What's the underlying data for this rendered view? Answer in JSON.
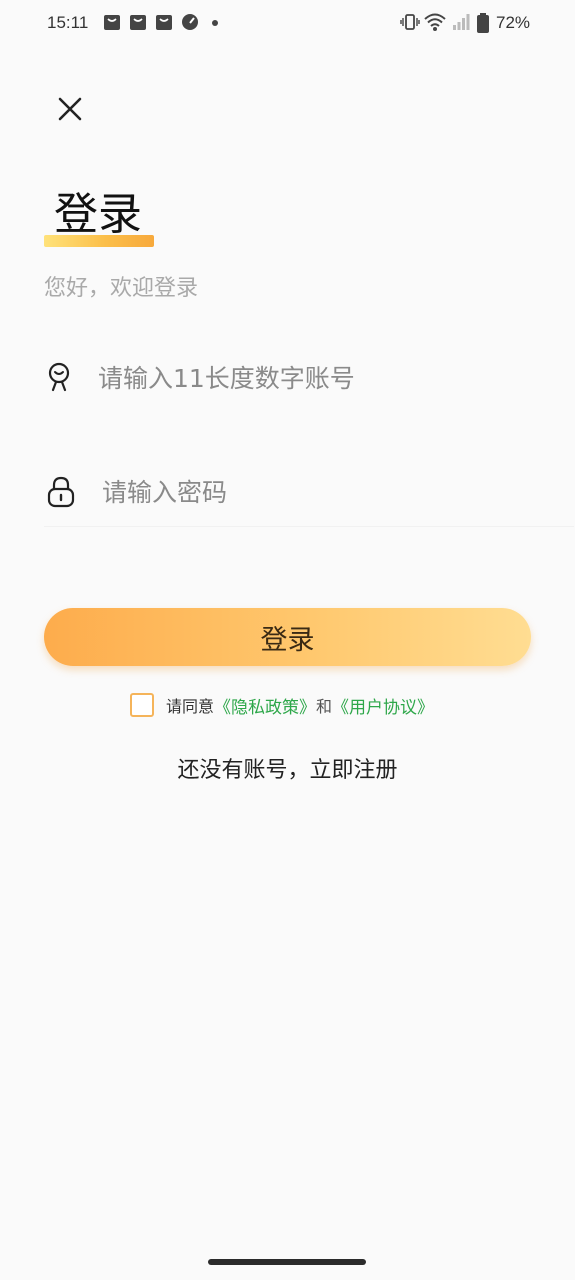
{
  "status_bar": {
    "time": "15:11",
    "battery_text": "72%",
    "icons": [
      "bag-icon",
      "bag-icon",
      "bag-icon",
      "gauge-icon",
      "dot-icon",
      "vibrate-icon",
      "wifi-icon",
      "signal-icon",
      "battery-icon"
    ]
  },
  "header": {
    "close_icon": "close-icon",
    "title": "登录",
    "subtitle": "您好，欢迎登录"
  },
  "form": {
    "account_placeholder": "请输入11长度数字账号",
    "account_value": "",
    "password_placeholder": "请输入密码",
    "password_value": "",
    "login_label": "登录"
  },
  "agreement": {
    "prefix": "请同意",
    "privacy": "《隐私政策》",
    "and": "和",
    "terms": "《用户协议》",
    "checked": false
  },
  "register": {
    "label": "还没有账号，立即注册"
  },
  "colors": {
    "accent_start": "#fdac4c",
    "accent_end": "#ffdd92",
    "link_green": "#2ea74a",
    "checkbox_border": "#f5b45a"
  }
}
